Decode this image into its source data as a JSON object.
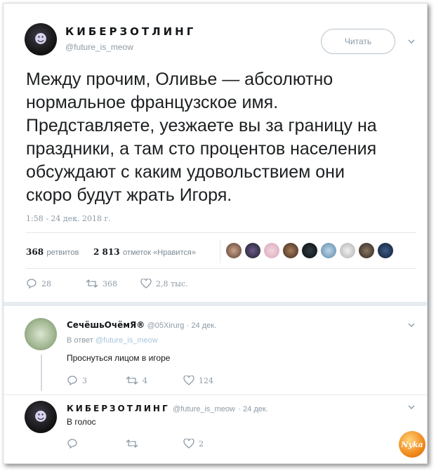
{
  "tweet": {
    "author_name": "КИБЕРЗОТЛИНГ",
    "author_handle": "@future_is_meow",
    "follow_label": "Читать",
    "text": "Между прочим, Оливье — абсолютно\nнормальное французское имя.\nПредставляете, уезжаете вы за границу на\nпраздники, а там сто процентов населения\nобсуждают с каким удовольствием они\nскоро будут жрать Игоря.",
    "timestamp": "1:58 - 24 дек. 2018 г.",
    "retweets_count": "368",
    "retweets_label": "ретвитов",
    "likes_count": "2 813",
    "likes_label": "отметок «Нравится»",
    "replies": "28",
    "retweets": "368",
    "likes": "2,8 тыс."
  },
  "replies": [
    {
      "author_name": "СечёшьОчёмЯ®",
      "author_handle": "@05Xirurg",
      "date": "· 24 дек.",
      "reply_to_prefix": "В ответ",
      "reply_to_handle": "@future_is_meow",
      "text": "Проснуться лицом в игоре",
      "replies": "3",
      "retweets": "4",
      "likes": "124"
    },
    {
      "author_name": "КИБЕРЗОТЛИНГ",
      "author_handle": "@future_is_meow",
      "date": "· 24 дек.",
      "text": "В голос",
      "replies": "",
      "retweets": "",
      "likes": "2"
    }
  ],
  "watermark": "Nyka",
  "colors": {
    "muted": "#8c9aa6",
    "text": "#14171a",
    "separator": "#e1e8ed"
  },
  "icons": [
    "chevron-down-icon",
    "reply-icon",
    "retweet-icon",
    "heart-icon"
  ]
}
